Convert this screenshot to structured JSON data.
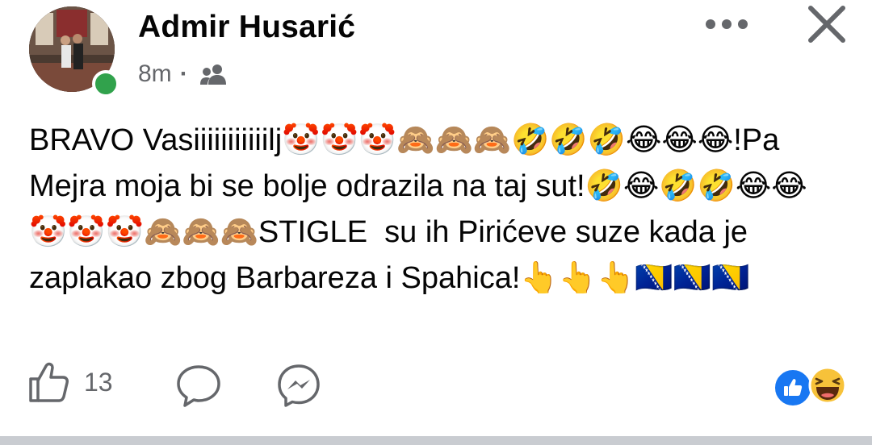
{
  "post": {
    "author": "Admir Husarić",
    "time": "8m",
    "separator": "·",
    "audience_icon": "friends-icon",
    "text": "BRAVO Vasiiiiiiiiiiilj🤡🤡🤡🙈🙈🙈🤣🤣🤣😂😂😂!Pa Mejra moja bi se bolje odrazila na taj sut!🤣😂🤣🤣😂😂🤡🤡🤡🙈🙈🙈STIGLE  su ih Pirićeve suze kada je zaplakao zbog Barbareza i Spahica!👆👆👆🇧🇦🇧🇦🇧🇦"
  },
  "actions": {
    "like_count": "13"
  },
  "colors": {
    "online": "#31a24c",
    "like_blue": "#1877f2",
    "muted": "#65676b"
  }
}
